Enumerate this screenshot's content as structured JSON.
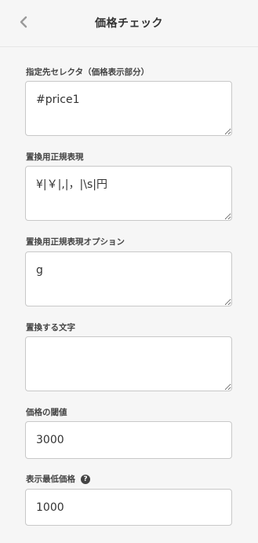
{
  "header": {
    "title": "価格チェック",
    "back_icon": "chevron-left-icon"
  },
  "fields": {
    "selector": {
      "label": "指定先セレクタ（価格表示部分）",
      "value": "#price1"
    },
    "regex": {
      "label": "置換用正規表現",
      "value": "¥|￥|,|，|\\s|円"
    },
    "regex_options": {
      "label": "置換用正規表現オプション",
      "value": "g"
    },
    "replace_text": {
      "label": "置換する文字",
      "value": ""
    },
    "threshold": {
      "label": "価格の閾値",
      "value": "3000"
    },
    "min_price": {
      "label": "表示最低価格",
      "value": "1000",
      "help_icon": "question-circle-icon",
      "help_glyph": "?"
    }
  }
}
